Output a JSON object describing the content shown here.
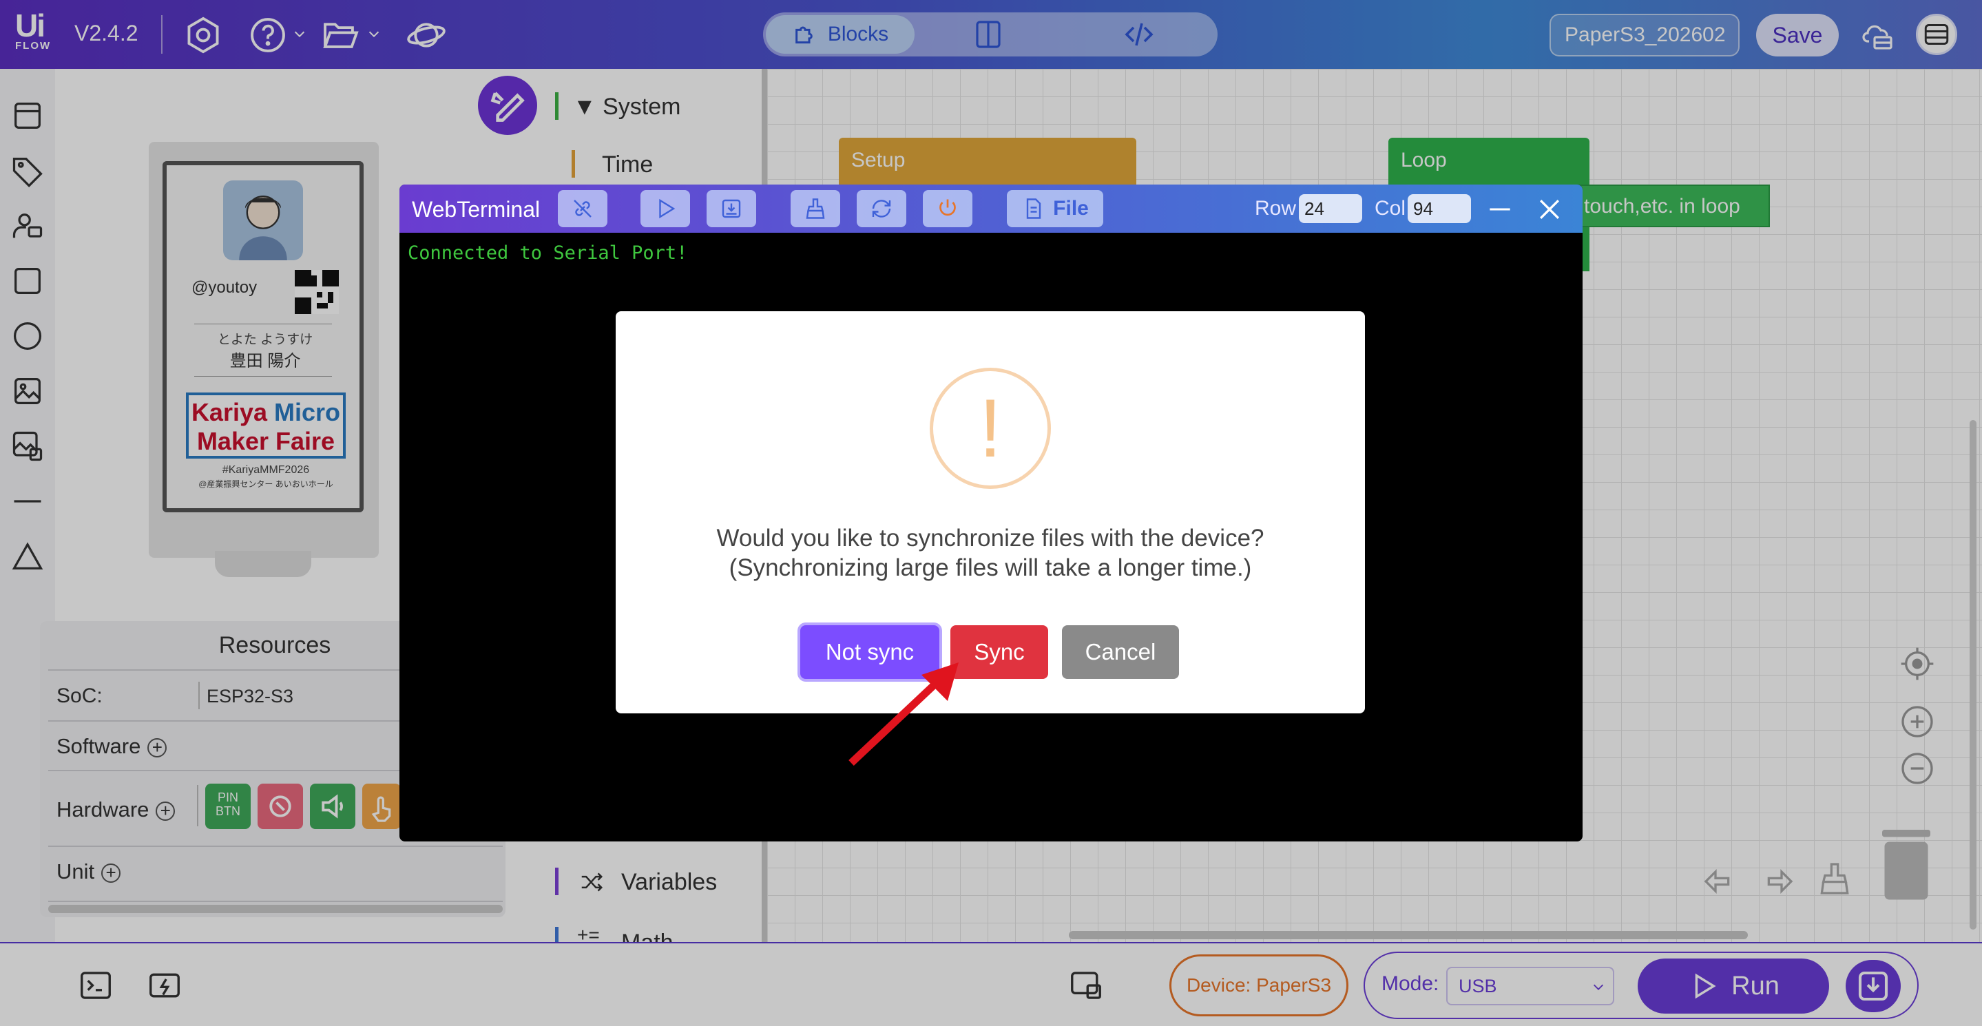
{
  "app": {
    "logo_ui": "Ui",
    "logo_flow": "FLOW",
    "version": "V2.4.2",
    "project_name": "PaperS3_202602",
    "save_label": "Save"
  },
  "view_tabs": {
    "blocks_label": "Blocks",
    "active": "Blocks"
  },
  "device_preview": {
    "handle": "@youtoy",
    "name_kana": "とよた ようすけ",
    "name_kanji": "豊田 陽介",
    "logo_line1a": "Kariya",
    "logo_line1b": "Micro",
    "logo_line2": "Maker Faire",
    "hashtag": "#KariyaMMF2026",
    "venue": "@産業振興センター あいおいホール"
  },
  "resources": {
    "title": "Resources",
    "soc_label": "SoC:",
    "soc_value": "ESP32-S3",
    "software_label": "Software",
    "hardware_label": "Hardware",
    "unit_label": "Unit",
    "hw_chip_pin": "PIN BTN"
  },
  "palette": {
    "categories": [
      {
        "label": "▼ System",
        "color": "#3cb043"
      },
      {
        "label": "Time",
        "color": "#e3a23a"
      },
      {
        "label": "Variables",
        "color": "#7b3fd6"
      },
      {
        "label": "Math",
        "color": "#3e78d8"
      }
    ]
  },
  "workspace": {
    "setup_block": "Setup",
    "loop_block": "Loop",
    "loop_inner": "touch,etc. in loop",
    "setup_color": "#e0a73a",
    "loop_color": "#2fb24c"
  },
  "terminal": {
    "title": "WebTerminal",
    "file_label": "File",
    "row_label": "Row",
    "row_value": "24",
    "col_label": "Col",
    "col_value": "94",
    "output": "Connected to Serial Port!"
  },
  "dialog": {
    "icon_glyph": "!",
    "message_line1": "Would you like to synchronize files with the device?",
    "message_line2": "(Synchronizing large files will take a longer time.)",
    "not_sync_label": "Not sync",
    "sync_label": "Sync",
    "cancel_label": "Cancel",
    "not_sync_color": "#7c4dff",
    "sync_color": "#e0333f",
    "cancel_color": "#8a8a8a"
  },
  "bottom": {
    "device_label": "Device: PaperS3",
    "mode_label": "Mode:",
    "mode_value": "USB",
    "run_label": "Run"
  },
  "icons": {
    "top": [
      "settings-icon",
      "help-icon",
      "folder-icon",
      "planet-icon"
    ],
    "rail": [
      "window-icon",
      "tag-icon",
      "user-group-icon",
      "square-icon",
      "circle-icon",
      "image-icon",
      "images-icon",
      "line-icon",
      "triangle-icon"
    ]
  }
}
